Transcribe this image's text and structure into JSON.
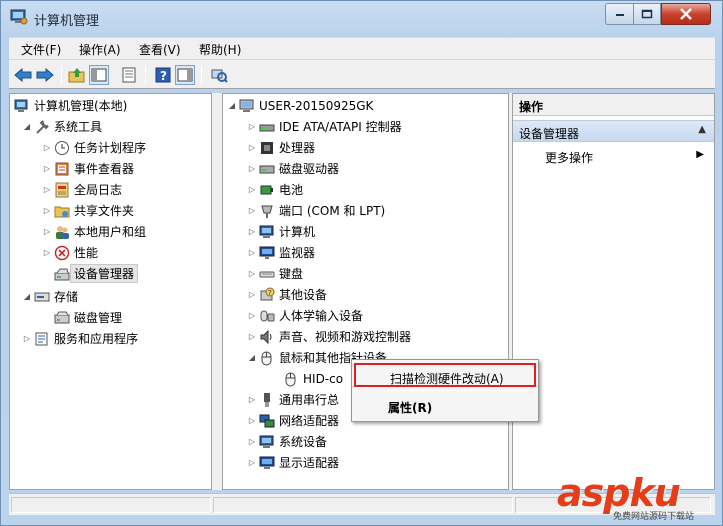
{
  "window": {
    "title": "计算机管理"
  },
  "menubar": [
    "文件(F)",
    "操作(A)",
    "查看(V)",
    "帮助(H)"
  ],
  "toolbar": [
    "back-icon",
    "forward-icon",
    "up-folder-icon",
    "console-tree-icon",
    "properties-icon",
    "help-icon",
    "help-panel-icon",
    "scan-hardware-icon"
  ],
  "left_tree": [
    {
      "label": "计算机管理(本地)",
      "icon": "computer-management-icon",
      "level": 0,
      "arrow": ""
    },
    {
      "label": "系统工具",
      "icon": "system-tools-icon",
      "level": 1,
      "arrow": "open"
    },
    {
      "label": "任务计划程序",
      "icon": "task-scheduler-icon",
      "level": 2,
      "arrow": "closed"
    },
    {
      "label": "事件查看器",
      "icon": "event-viewer-icon",
      "level": 2,
      "arrow": "closed"
    },
    {
      "label": "全局日志",
      "icon": "global-log-icon",
      "level": 2,
      "arrow": "closed"
    },
    {
      "label": "共享文件夹",
      "icon": "shared-folder-icon",
      "level": 2,
      "arrow": "closed"
    },
    {
      "label": "本地用户和组",
      "icon": "local-users-icon",
      "level": 2,
      "arrow": "closed"
    },
    {
      "label": "性能",
      "icon": "performance-icon",
      "level": 2,
      "arrow": "closed"
    },
    {
      "label": "设备管理器",
      "icon": "device-manager-icon",
      "level": 2,
      "arrow": "",
      "selected": true
    },
    {
      "label": "存储",
      "icon": "storage-icon",
      "level": 1,
      "arrow": "open"
    },
    {
      "label": "磁盘管理",
      "icon": "disk-management-icon",
      "level": 2,
      "arrow": ""
    },
    {
      "label": "服务和应用程序",
      "icon": "services-apps-icon",
      "level": 1,
      "arrow": "closed"
    }
  ],
  "device_tree": {
    "root": "USER-20150925GK",
    "items": [
      {
        "label": "IDE ATA/ATAPI 控制器",
        "icon": "ide-controller-icon",
        "arrow": "closed"
      },
      {
        "label": "处理器",
        "icon": "processor-icon",
        "arrow": "closed"
      },
      {
        "label": "磁盘驱动器",
        "icon": "disk-drive-icon",
        "arrow": "closed"
      },
      {
        "label": "电池",
        "icon": "battery-icon",
        "arrow": "closed"
      },
      {
        "label": "端口 (COM 和 LPT)",
        "icon": "port-icon",
        "arrow": "closed"
      },
      {
        "label": "计算机",
        "icon": "computer-icon",
        "arrow": "closed"
      },
      {
        "label": "监视器",
        "icon": "monitor-icon",
        "arrow": "closed"
      },
      {
        "label": "键盘",
        "icon": "keyboard-icon",
        "arrow": "closed"
      },
      {
        "label": "其他设备",
        "icon": "other-devices-icon",
        "arrow": "closed"
      },
      {
        "label": "人体学输入设备",
        "icon": "hid-icon",
        "arrow": "closed"
      },
      {
        "label": "声音、视频和游戏控制器",
        "icon": "sound-icon",
        "arrow": "closed"
      },
      {
        "label": "鼠标和其他指针设备",
        "icon": "mouse-icon",
        "arrow": "open"
      },
      {
        "label": "HID-co",
        "icon": "mouse-icon",
        "arrow": "",
        "child": true
      },
      {
        "label": "通用串行总",
        "icon": "usb-icon",
        "arrow": "closed"
      },
      {
        "label": "网络适配器",
        "icon": "network-icon",
        "arrow": "closed"
      },
      {
        "label": "系统设备",
        "icon": "system-device-icon",
        "arrow": "closed"
      },
      {
        "label": "显示适配器",
        "icon": "display-adapter-icon",
        "arrow": "closed"
      }
    ]
  },
  "actions": {
    "header": "操作",
    "section": "设备管理器",
    "item": "更多操作"
  },
  "context_menu": {
    "scan": "扫描检测硬件改动(A)",
    "properties": "属性(R)"
  },
  "watermark": {
    "brand": "aspku",
    "sub": "免费网站源码下载站"
  }
}
